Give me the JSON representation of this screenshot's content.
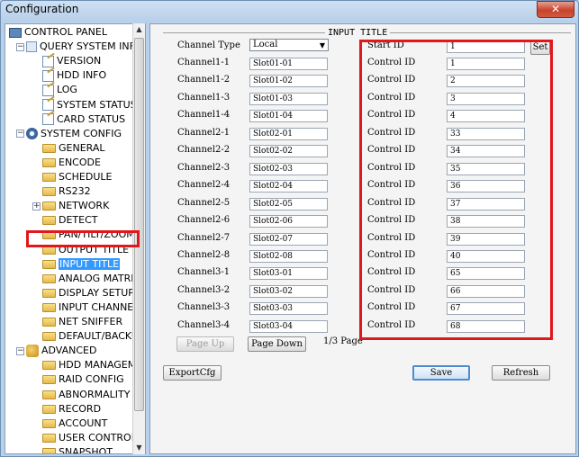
{
  "window": {
    "title": "Configuration",
    "close_label": "✕"
  },
  "tree": {
    "items": [
      {
        "label": "CONTROL PANEL",
        "icon": "monitor-icon",
        "level": 0
      },
      {
        "label": "QUERY SYSTEM INFO",
        "icon": "query-icon",
        "level": 1,
        "expander": "−"
      },
      {
        "label": "VERSION",
        "icon": "document-icon",
        "level": 2
      },
      {
        "label": "HDD INFO",
        "icon": "document-icon",
        "level": 2
      },
      {
        "label": "LOG",
        "icon": "document-icon",
        "level": 2
      },
      {
        "label": "SYSTEM STATUS",
        "icon": "document-icon",
        "level": 2
      },
      {
        "label": "CARD STATUS",
        "icon": "document-icon",
        "level": 2
      },
      {
        "label": "SYSTEM CONFIG",
        "icon": "gear-icon",
        "level": 1,
        "expander": "−"
      },
      {
        "label": "GENERAL",
        "icon": "folder-icon",
        "level": 2
      },
      {
        "label": "ENCODE",
        "icon": "folder-icon",
        "level": 2
      },
      {
        "label": "SCHEDULE",
        "icon": "folder-icon",
        "level": 2
      },
      {
        "label": "RS232",
        "icon": "folder-icon",
        "level": 2
      },
      {
        "label": "NETWORK",
        "icon": "folder-icon",
        "level": 2,
        "expander": "+"
      },
      {
        "label": "DETECT",
        "icon": "folder-icon",
        "level": 2
      },
      {
        "label": "PAN/TILT/ZOOM",
        "icon": "folder-icon",
        "level": 2
      },
      {
        "label": "OUTPUT TITLE",
        "icon": "folder-icon",
        "level": 2
      },
      {
        "label": "INPUT TITLE",
        "icon": "folder-icon",
        "level": 2,
        "selected": true
      },
      {
        "label": "ANALOG MATRIX",
        "icon": "folder-icon",
        "level": 2
      },
      {
        "label": "DISPLAY SETUP",
        "icon": "folder-icon",
        "level": 2
      },
      {
        "label": "INPUT CHANNEL",
        "icon": "folder-icon",
        "level": 2
      },
      {
        "label": "NET SNIFFER",
        "icon": "folder-icon",
        "level": 2
      },
      {
        "label": "DEFAULT/BACKUP",
        "icon": "folder-icon",
        "level": 2
      },
      {
        "label": "ADVANCED",
        "icon": "advanced-icon",
        "level": 1,
        "expander": "−"
      },
      {
        "label": "HDD MANAGEMENT",
        "icon": "folder-icon",
        "level": 2
      },
      {
        "label": "RAID CONFIG",
        "icon": "folder-icon",
        "level": 2
      },
      {
        "label": "ABNORMALITY",
        "icon": "folder-icon",
        "level": 2
      },
      {
        "label": "RECORD",
        "icon": "folder-icon",
        "level": 2
      },
      {
        "label": "ACCOUNT",
        "icon": "folder-icon",
        "level": 2
      },
      {
        "label": "USER CONTROL",
        "icon": "folder-icon",
        "level": 2
      },
      {
        "label": "SNAPSHOT",
        "icon": "folder-icon",
        "level": 2
      }
    ]
  },
  "panel": {
    "group_title": "INPUT TITLE",
    "channel_type_label": "Channel Type",
    "channel_type_value": "Local",
    "start_id_label": "Start ID",
    "start_id_value": "1",
    "set_label": "Set",
    "rows": [
      {
        "channel": "Channel1-1",
        "slot": "Slot01-01",
        "control_label": "Control ID",
        "control_id": "1"
      },
      {
        "channel": "Channel1-2",
        "slot": "Slot01-02",
        "control_label": "Control ID",
        "control_id": "2"
      },
      {
        "channel": "Channel1-3",
        "slot": "Slot01-03",
        "control_label": "Control ID",
        "control_id": "3"
      },
      {
        "channel": "Channel1-4",
        "slot": "Slot01-04",
        "control_label": "Control ID",
        "control_id": "4"
      },
      {
        "channel": "Channel2-1",
        "slot": "Slot02-01",
        "control_label": "Control ID",
        "control_id": "33"
      },
      {
        "channel": "Channel2-2",
        "slot": "Slot02-02",
        "control_label": "Control ID",
        "control_id": "34"
      },
      {
        "channel": "Channel2-3",
        "slot": "Slot02-03",
        "control_label": "Control ID",
        "control_id": "35"
      },
      {
        "channel": "Channel2-4",
        "slot": "Slot02-04",
        "control_label": "Control ID",
        "control_id": "36"
      },
      {
        "channel": "Channel2-5",
        "slot": "Slot02-05",
        "control_label": "Control ID",
        "control_id": "37"
      },
      {
        "channel": "Channel2-6",
        "slot": "Slot02-06",
        "control_label": "Control ID",
        "control_id": "38"
      },
      {
        "channel": "Channel2-7",
        "slot": "Slot02-07",
        "control_label": "Control ID",
        "control_id": "39"
      },
      {
        "channel": "Channel2-8",
        "slot": "Slot02-08",
        "control_label": "Control ID",
        "control_id": "40"
      },
      {
        "channel": "Channel3-1",
        "slot": "Slot03-01",
        "control_label": "Control ID",
        "control_id": "65"
      },
      {
        "channel": "Channel3-2",
        "slot": "Slot03-02",
        "control_label": "Control ID",
        "control_id": "66"
      },
      {
        "channel": "Channel3-3",
        "slot": "Slot03-03",
        "control_label": "Control ID",
        "control_id": "67"
      },
      {
        "channel": "Channel3-4",
        "slot": "Slot03-04",
        "control_label": "Control ID",
        "control_id": "68"
      }
    ],
    "page_up_label": "Page Up",
    "page_down_label": "Page Down",
    "page_indicator": "1/3 Page",
    "export_label": "ExportCfg",
    "save_label": "Save",
    "refresh_label": "Refresh"
  },
  "colors": {
    "highlight": "#e2171b",
    "window_bg": "#b9d0ea",
    "selection_bg": "#3399ff"
  }
}
